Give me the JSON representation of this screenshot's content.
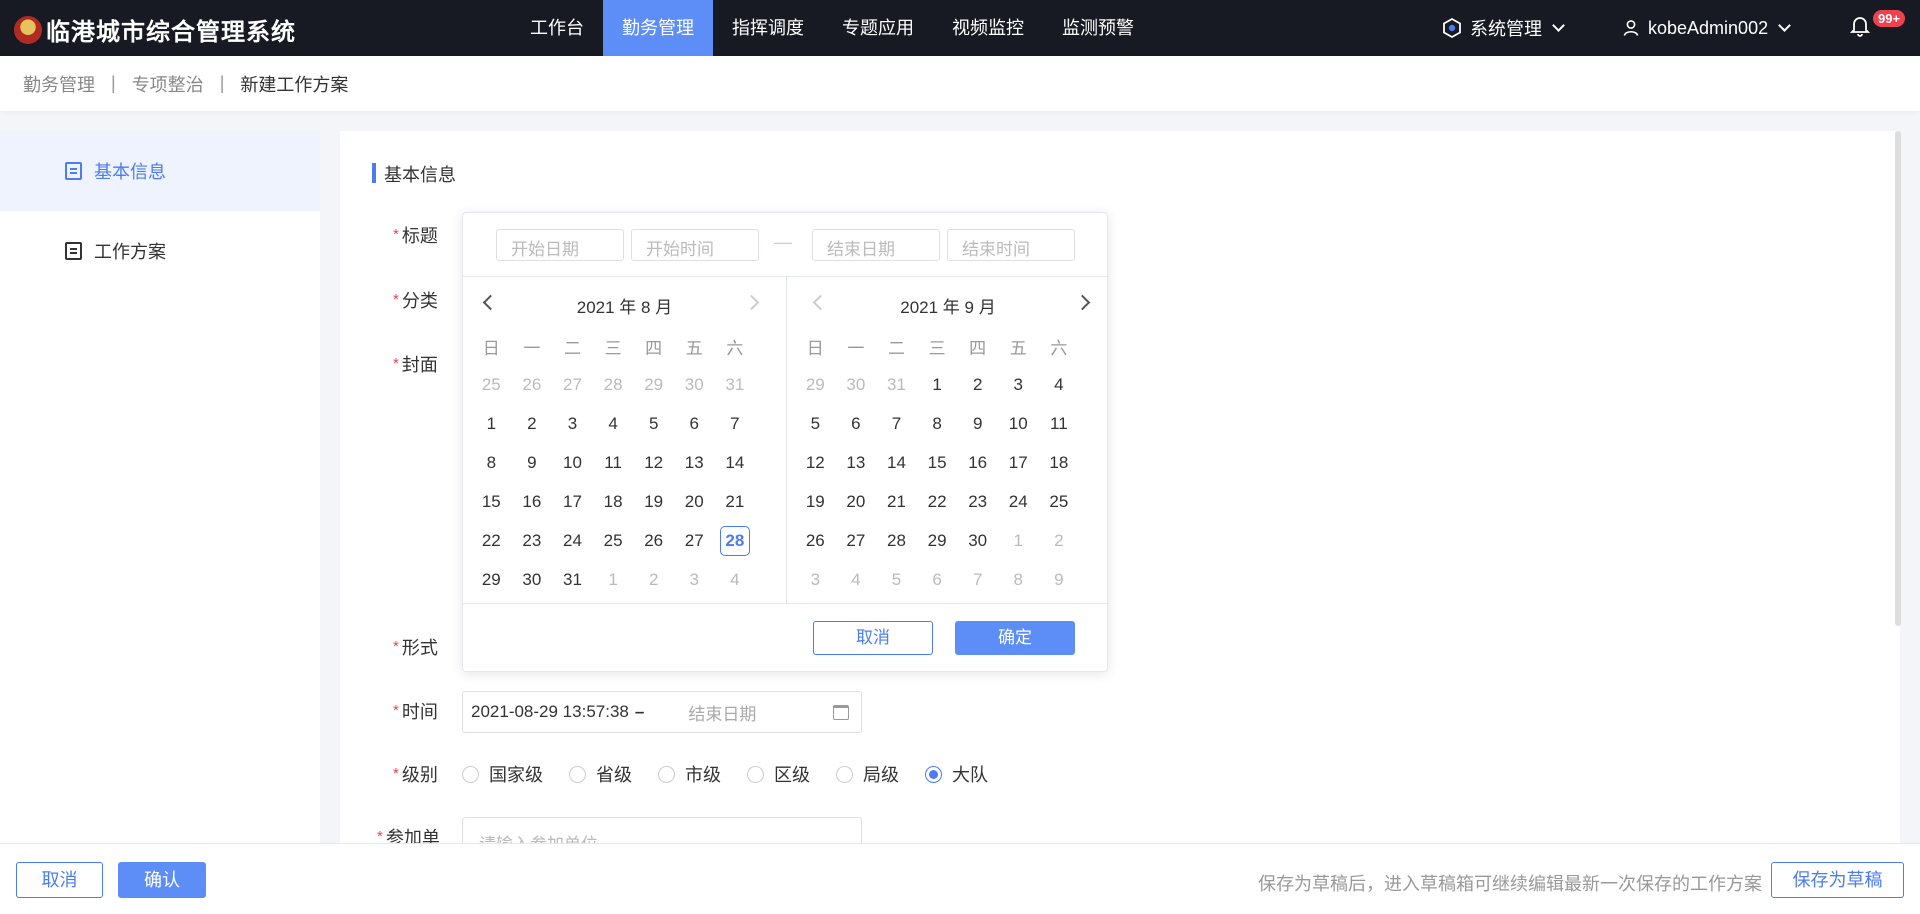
{
  "app": {
    "title": "临港城市综合管理系统",
    "badge_count": "99+"
  },
  "nav": [
    {
      "label": "工作台",
      "active": false
    },
    {
      "label": "勤务管理",
      "active": true
    },
    {
      "label": "指挥调度",
      "active": false
    },
    {
      "label": "专题应用",
      "active": false
    },
    {
      "label": "视频监控",
      "active": false
    },
    {
      "label": "监测预警",
      "active": false
    }
  ],
  "header": {
    "system_menu": "系统管理",
    "user": "kobeAdmin002"
  },
  "breadcrumb": [
    "勤务管理",
    "专项整治",
    "新建工作方案"
  ],
  "sidenav": [
    {
      "label": "基本信息",
      "icon": "info-card-icon",
      "active": true
    },
    {
      "label": "工作方案",
      "icon": "document-icon",
      "active": false
    }
  ],
  "form": {
    "section_title": "基本信息",
    "labels": {
      "title": "标题",
      "category": "分类",
      "cover": "封面",
      "format": "形式",
      "time": "时间",
      "level": "级别",
      "participants": "参加单"
    },
    "time_value": "2021-08-29 13:57:38",
    "time_separator": "–",
    "time_end_placeholder": "结束日期",
    "levels": [
      "国家级",
      "省级",
      "市级",
      "区级",
      "局级",
      "大队"
    ],
    "level_selected": "大队",
    "participants_placeholder": "请输入参加单位"
  },
  "picker": {
    "start_date_placeholder": "开始日期",
    "start_time_placeholder": "开始时间",
    "end_date_placeholder": "结束日期",
    "end_time_placeholder": "结束时间",
    "dash": "—",
    "weekdays": [
      "日",
      "一",
      "二",
      "三",
      "四",
      "五",
      "六"
    ],
    "left_month": {
      "title": "2021 年 8 月",
      "days": [
        "25",
        "26",
        "27",
        "28",
        "29",
        "30",
        "31",
        "1",
        "2",
        "3",
        "4",
        "5",
        "6",
        "7",
        "8",
        "9",
        "10",
        "11",
        "12",
        "13",
        "14",
        "15",
        "16",
        "17",
        "18",
        "19",
        "20",
        "21",
        "22",
        "23",
        "24",
        "25",
        "26",
        "27",
        "28",
        "29",
        "30",
        "31",
        "1",
        "2",
        "3",
        "4"
      ],
      "first_current_index": 7,
      "last_current_index": 37,
      "today_index": 34
    },
    "right_month": {
      "title": "2021 年 9 月",
      "days": [
        "29",
        "30",
        "31",
        "1",
        "2",
        "3",
        "4",
        "5",
        "6",
        "7",
        "8",
        "9",
        "10",
        "11",
        "12",
        "13",
        "14",
        "15",
        "16",
        "17",
        "18",
        "19",
        "20",
        "21",
        "22",
        "23",
        "24",
        "25",
        "26",
        "27",
        "28",
        "29",
        "30",
        "1",
        "2",
        "3",
        "4",
        "5",
        "6",
        "7",
        "8",
        "9"
      ],
      "first_current_index": 3,
      "last_current_index": 32
    },
    "cancel": "取消",
    "confirm": "确定"
  },
  "footer": {
    "cancel": "取消",
    "confirm": "确认",
    "hint": "保存为草稿后，进入草稿箱可继续编辑最新一次保存的工作方案",
    "save_draft": "保存为草稿"
  },
  "colors": {
    "accent": "#5d8ef7",
    "topbar": "#171a23",
    "required": "#f0424e"
  }
}
